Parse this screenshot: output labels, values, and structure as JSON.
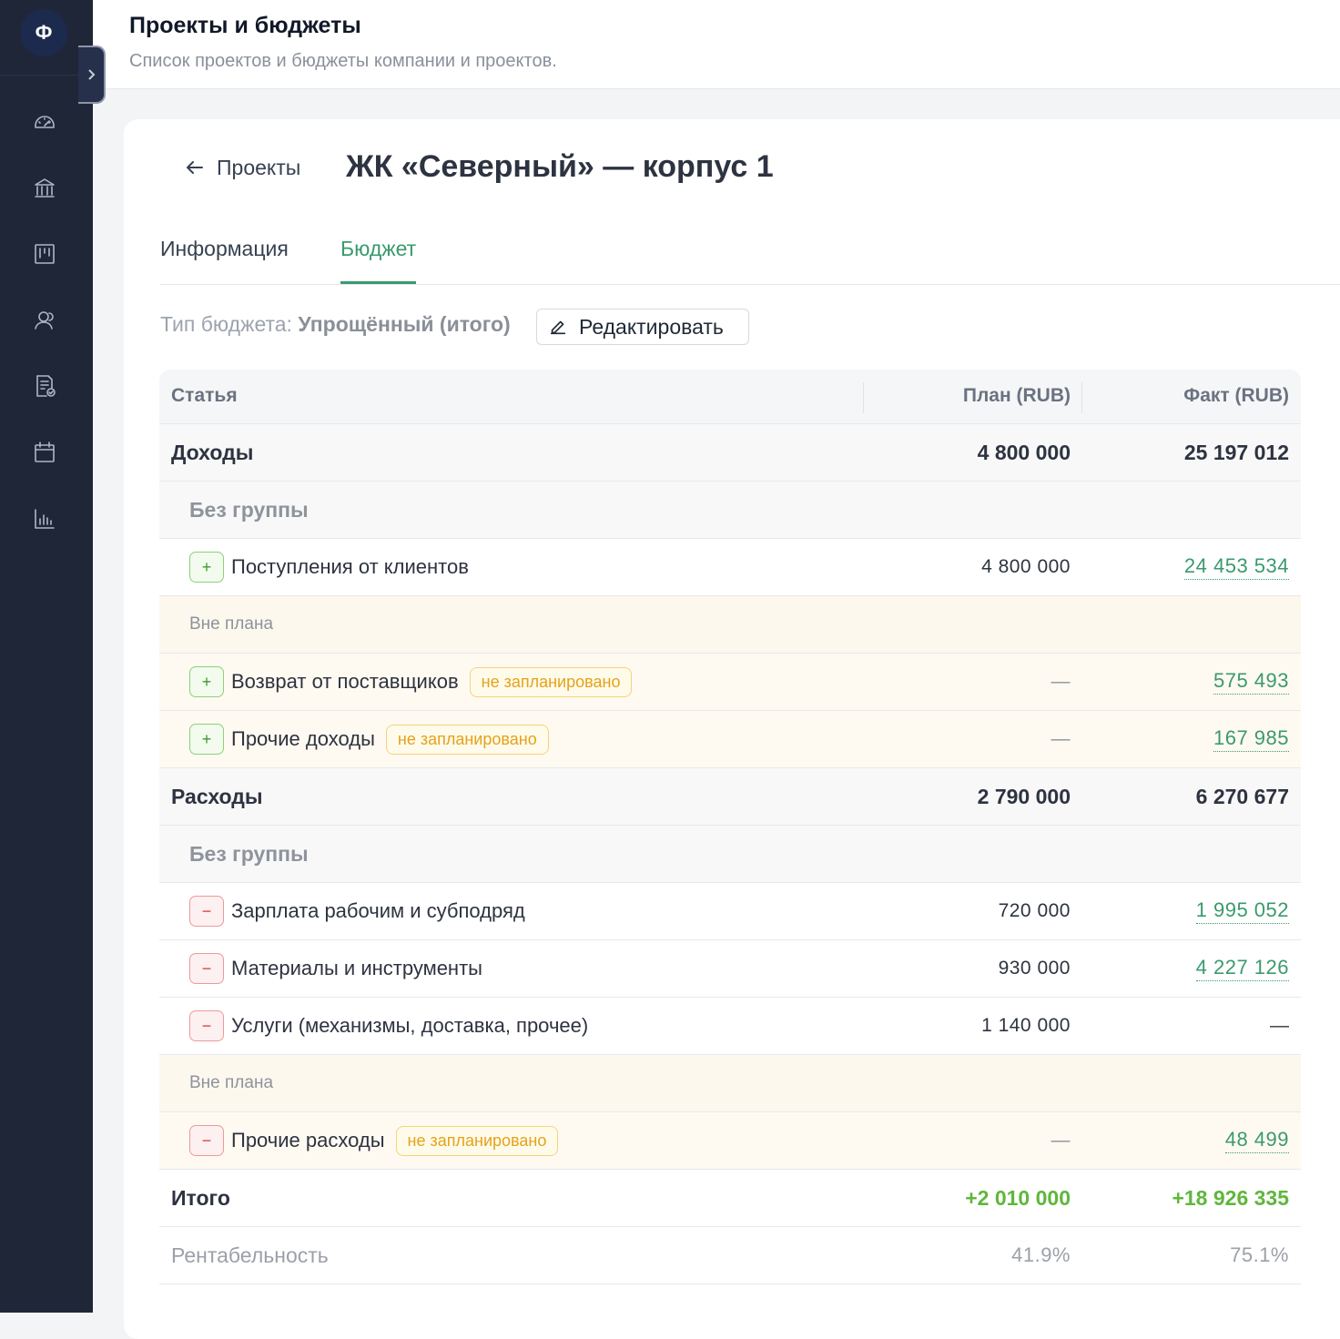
{
  "sidebar": {
    "logo_letter": "Ф",
    "icons": [
      "dashboard-icon",
      "bank-icon",
      "kanban-icon",
      "users-icon",
      "document-check-icon",
      "calendar-icon",
      "chart-icon"
    ]
  },
  "header": {
    "title": "Проекты и бюджеты",
    "subtitle": "Список проектов и бюджеты компании и проектов."
  },
  "project": {
    "back_label": "Проекты",
    "title": "ЖК «Северный» — корпус 1"
  },
  "tabs": [
    {
      "label": "Информация",
      "active": false
    },
    {
      "label": "Бюджет",
      "active": true
    }
  ],
  "budget": {
    "type_label": "Тип бюджета:",
    "type_value": "Упрощённый (итого)",
    "edit_label": "Редактировать"
  },
  "table": {
    "columns": {
      "item": "Статья",
      "plan": "План (RUB)",
      "fact": "Факт (RUB)"
    },
    "income": {
      "label": "Доходы",
      "plan": "4 800 000",
      "fact": "25 197 012",
      "group_label": "Без группы",
      "items": [
        {
          "sign": "+",
          "label": "Поступления от клиентов",
          "plan": "4 800 000",
          "fact": "24 453 534"
        }
      ],
      "offplan_label": "Вне плана",
      "offplan_items": [
        {
          "sign": "+",
          "label": "Возврат от поставщиков",
          "badge": "не запланировано",
          "plan": "—",
          "fact": "575 493"
        },
        {
          "sign": "+",
          "label": "Прочие доходы",
          "badge": "не запланировано",
          "plan": "—",
          "fact": "167 985"
        }
      ]
    },
    "expense": {
      "label": "Расходы",
      "plan": "2 790 000",
      "fact": "6 270 677",
      "group_label": "Без группы",
      "items": [
        {
          "sign": "−",
          "label": "Зарплата рабочим и субподряд",
          "plan": "720 000",
          "fact": "1 995 052"
        },
        {
          "sign": "−",
          "label": "Материалы и инструменты",
          "plan": "930 000",
          "fact": "4 227 126"
        },
        {
          "sign": "−",
          "label": "Услуги (механизмы, доставка, прочее)",
          "plan": "1 140 000",
          "fact": "—"
        }
      ],
      "offplan_label": "Вне плана",
      "offplan_items": [
        {
          "sign": "−",
          "label": "Прочие расходы",
          "badge": "не запланировано",
          "plan": "—",
          "fact": "48 499"
        }
      ]
    },
    "total": {
      "label": "Итого",
      "plan": "+2 010 000",
      "fact": "+18 926 335"
    },
    "profitability": {
      "label": "Рентабельность",
      "plan": "41.9%",
      "fact": "75.1%"
    }
  },
  "colors": {
    "sidebar_bg": "#1e2638",
    "accent": "#3a9a6e",
    "positive": "#5fb73c",
    "badge": "#e4a21b"
  }
}
